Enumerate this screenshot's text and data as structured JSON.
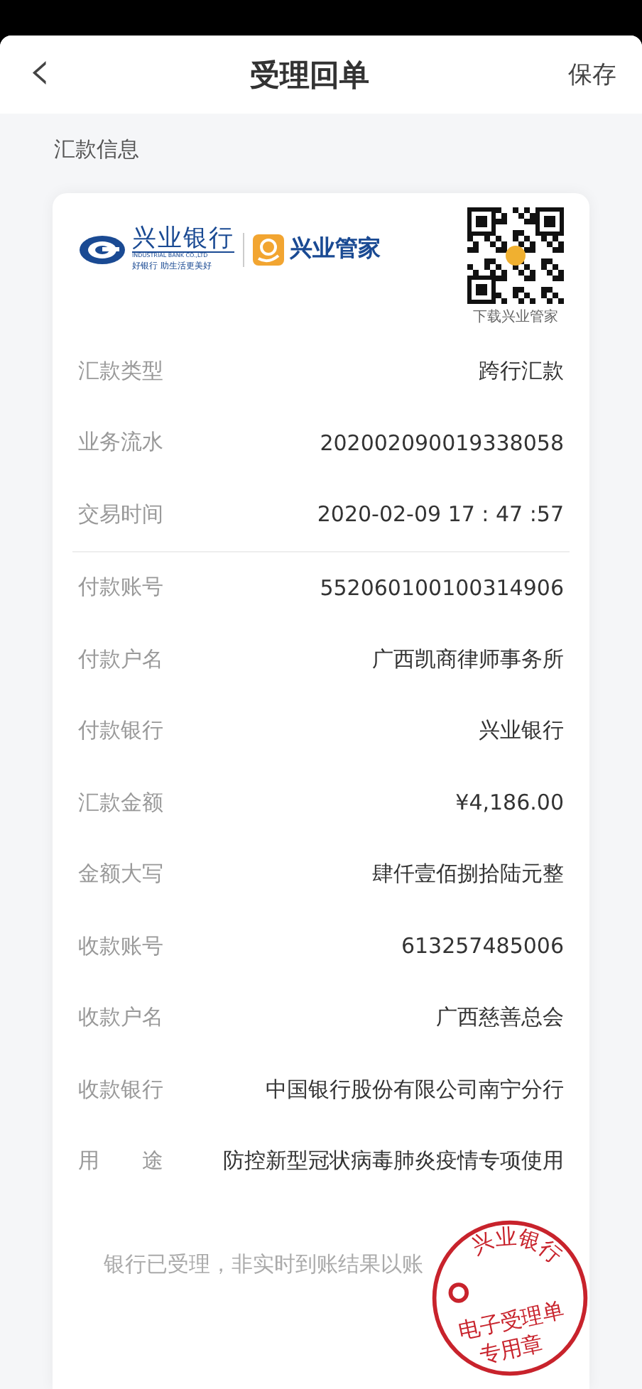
{
  "header": {
    "back_icon": "‹",
    "title": "受理回单",
    "action": "保存"
  },
  "section_title": "汇款信息",
  "card": {
    "logo": {
      "bank_name": "兴业银行",
      "bank_english": "INDUSTRIAL BANK CO.,LTD",
      "slogan": "好银行 助生活更美好",
      "app_name": "兴业管家"
    },
    "qr_caption": "下载兴业管家",
    "groups": [
      [
        {
          "label": "汇款类型",
          "value": "跨行汇款"
        },
        {
          "label": "业务流水",
          "value": "202002090019338058"
        },
        {
          "label": "交易时间",
          "value": "2020-02-09 17 : 47 :57"
        }
      ],
      [
        {
          "label": "付款账号",
          "value": "552060100100314906"
        },
        {
          "label": "付款户名",
          "value": "广西凯商律师事务所"
        },
        {
          "label": "付款银行",
          "value": "兴业银行"
        },
        {
          "label": "汇款金额",
          "value": "¥4,186.00"
        },
        {
          "label": "金额大写",
          "value": "肆仟壹佰捌拾陆元整"
        },
        {
          "label": "收款账号",
          "value": "613257485006"
        },
        {
          "label": "收款户名",
          "value": "广西慈善总会"
        },
        {
          "label": "收款银行",
          "value": "中国银行股份有限公司南宁分行"
        },
        {
          "label": "用　　途",
          "value": "防控新型冠状病毒肺炎疫情专项使用"
        }
      ]
    ],
    "notice": "银行已受理，非实时到账结果以账",
    "stamp": {
      "top_text": "兴业银行",
      "middle_text": "电子受理单",
      "bottom_text": "专用章"
    }
  }
}
